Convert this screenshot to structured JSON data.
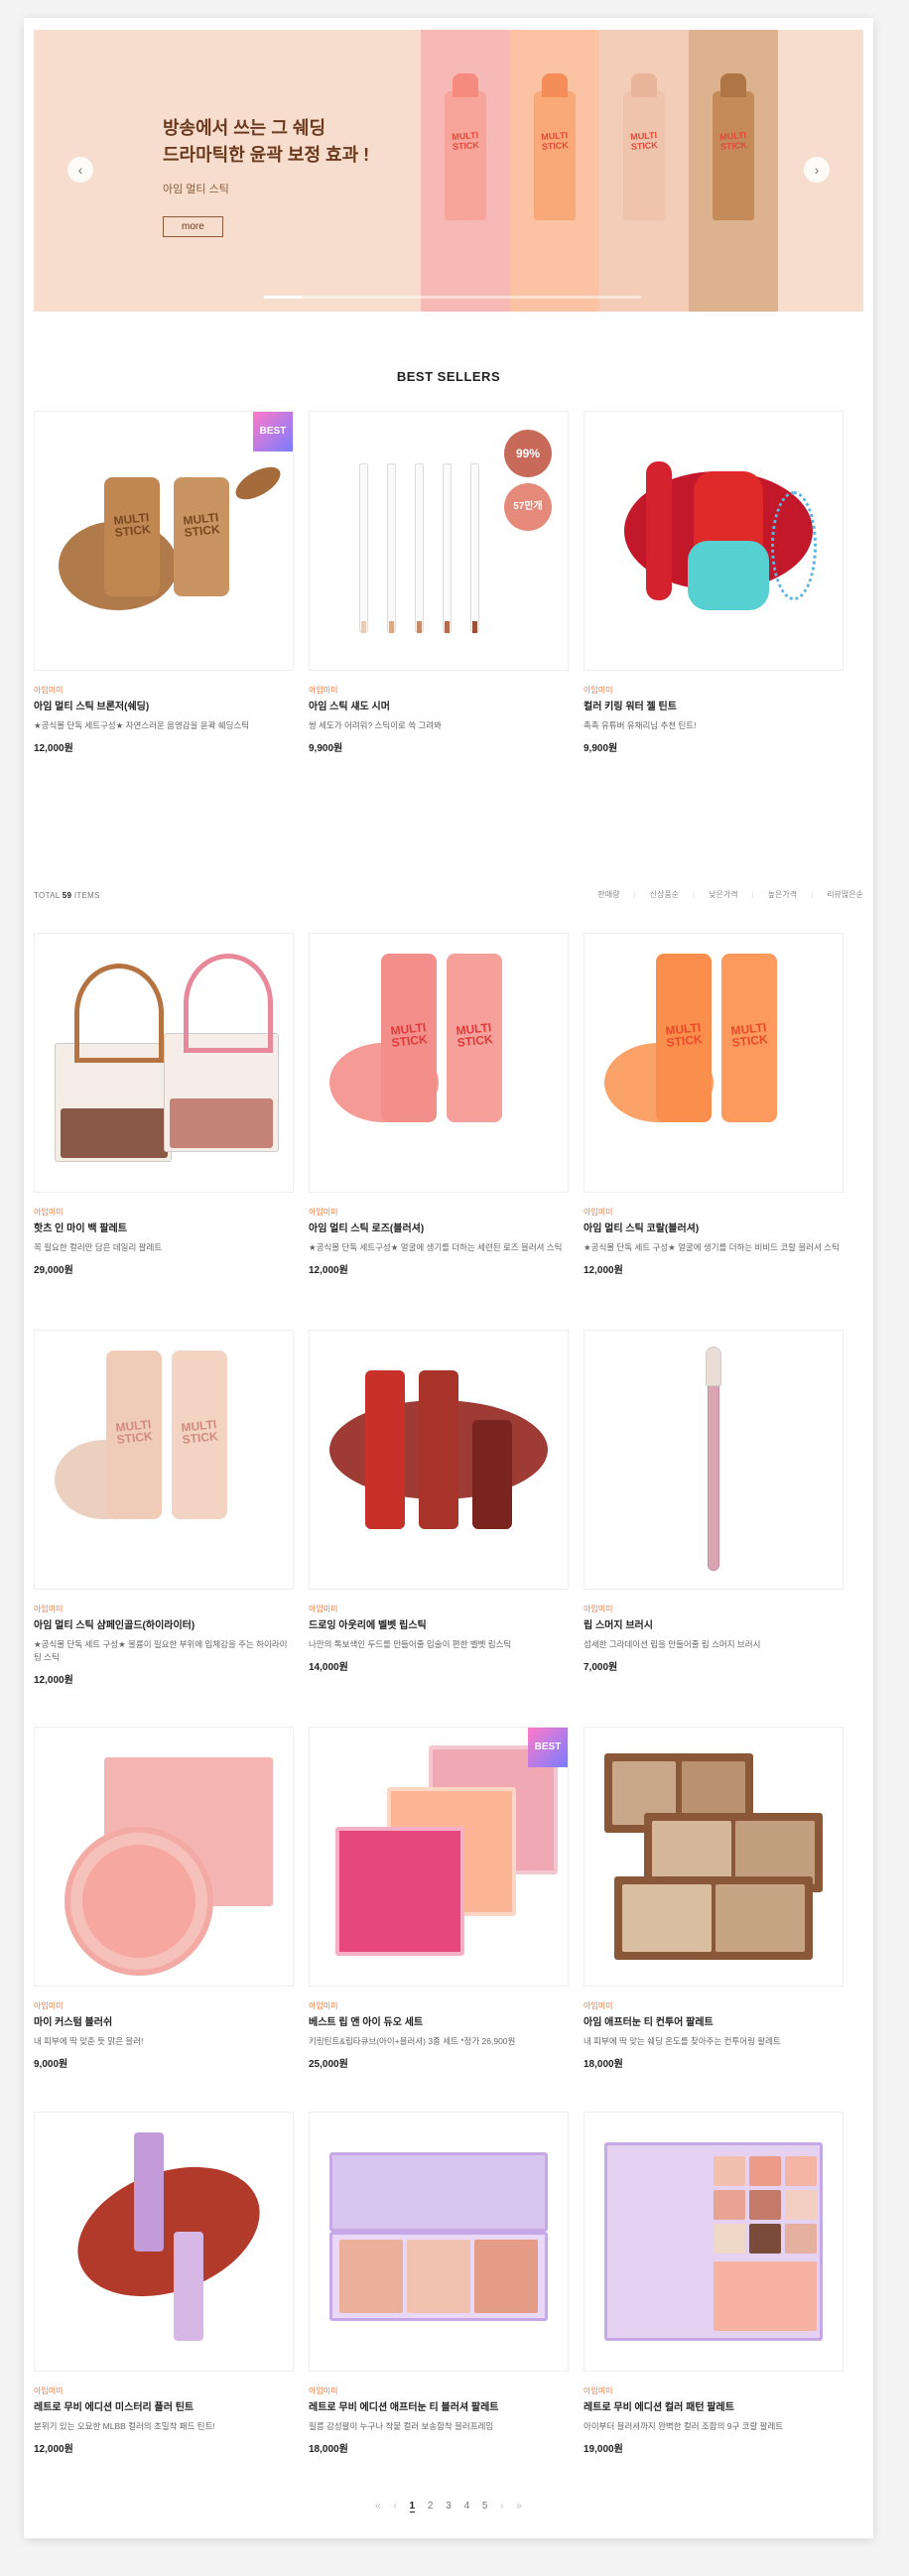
{
  "banner": {
    "title": "방송에서 쓰는 그 쉐딩\n드라마틱한 윤곽 보정 효과 !",
    "subtitle": "아임 멀티 스틱",
    "more_label": "more",
    "prev_icon": "‹",
    "next_icon": "›",
    "sticks": [
      {
        "label": "MULTI STICK",
        "bg": "#f6b9b6",
        "color": "#f38478"
      },
      {
        "label": "MULTI STICK",
        "bg": "#fbc2a3",
        "color": "#f58d59"
      },
      {
        "label": "MULTI STICK",
        "bg": "#f3cdb8",
        "color": "#e9b59a"
      },
      {
        "label": "MULTI STICK",
        "bg": "#dcb38e",
        "color": "#b07545"
      }
    ]
  },
  "best_sellers": {
    "title": "BEST SELLERS",
    "badge": "BEST",
    "bubble_top": "99%",
    "bubble_bottom": "57만개",
    "items": [
      {
        "brand": "아임미미",
        "name": "아임 멀티 스틱 브론저(쉐딩)",
        "desc": "★공식몰 단독 세트구성★ 자연스러운 음영감을 윤곽 쉐딩스틱",
        "price": "12,000원"
      },
      {
        "brand": "아임미미",
        "name": "아임 스틱 섀도 시머",
        "desc": "쌍 세도가 어려워? 스틱이로 쓱 그려봐",
        "price": "9,900원"
      },
      {
        "brand": "아임미미",
        "name": "컬러 키링 워터 젤 틴트",
        "desc": "촉촉 유튜버 유채리님 추천 틴트!",
        "price": "9,900원"
      }
    ]
  },
  "listing": {
    "total_prefix": "TOTAL",
    "total_count": "59",
    "total_suffix": "ITEMS",
    "sort_options": [
      "판매량",
      "신상품순",
      "낮은가격",
      "높은가격",
      "리뷰많은순"
    ]
  },
  "products": [
    {
      "brand": "아임미미",
      "name": "핫츠 인 마이 백 팔레트",
      "desc": "꼭 필요한 컬러만 담은 데일리 팔레트",
      "price": "29,000원"
    },
    {
      "brand": "아임미미",
      "name": "아임 멀티 스틱 로즈(블러셔)",
      "desc": "★공식몰 단독 세트구성★ 얼굴에 생기를 더하는 세련된 로즈 블러셔 스틱",
      "price": "12,000원"
    },
    {
      "brand": "아임미미",
      "name": "아임 멀티 스틱 코랄(블러셔)",
      "desc": "★공식몰 단독 세트 구성★ 얼굴에 생기를 더하는 비비드 코랄 블러셔 스틱",
      "price": "12,000원"
    },
    {
      "brand": "아임미미",
      "name": "아임 멀티 스틱 샴페인골드(하이라이터)",
      "desc": "★공식몰 단독 세트 구성★ 볼륨이 필요한 부위에 입체감을 주는 하이라이팅 스틱",
      "price": "12,000원"
    },
    {
      "brand": "아임미미",
      "name": "드로잉 아웃리에 벨벳 립스틱",
      "desc": "나만의 톡보색인 두드를 만들어줄 입술이 편한 벨벳 립스틱",
      "price": "14,000원"
    },
    {
      "brand": "아임미미",
      "name": "립 스머지 브러시",
      "desc": "섬세한 그라데이션 립을 만들어줄 립 스머지 브러시",
      "price": "7,000원"
    },
    {
      "brand": "아임미미",
      "name": "마이 커스텀 블러쉬",
      "desc": "내 피부에 딱 맞춘 듯 맑은 블러!",
      "price": "9,000원"
    },
    {
      "brand": "아임미미",
      "name": "베스트 립 앤 아이 듀오 세트",
      "desc": "키링틴트&립타큐브(아이+블러셔) 3종 세트 *정가 26,900원",
      "price": "25,000원"
    },
    {
      "brand": "아임미미",
      "name": "아임 애프터눈 티 컨투어 팔레트",
      "desc": "내 피부에 딱 맞는 쉐딩 온도를 찾아주는 컨투어링 팔레트",
      "price": "18,000원"
    },
    {
      "brand": "아임미미",
      "name": "레트로 무비 에디션 미스터리 플러 틴트",
      "desc": "분위기 있는 오묘한 MLBB 컬러의 초밀착 패드 틴트!",
      "price": "12,000원"
    },
    {
      "brand": "아임미미",
      "name": "레트로 무비 에디션 애프터눈 티 블러셔 팔레트",
      "desc": "필름 감성팔이 누구나 착붙 컬러 보송함착 블러프레임",
      "price": "18,000원"
    },
    {
      "brand": "아임미미",
      "name": "레트로 무비 에디션 컬러 패턴 팔레트",
      "desc": "아이부터 블러셔까지 완벽한 컬러 조합의 9구 코랄 팔레트",
      "price": "19,000원"
    }
  ],
  "pagination": {
    "first": "«",
    "prev": "‹",
    "pages": [
      "1",
      "2",
      "3",
      "4",
      "5"
    ],
    "next": "›",
    "last": "»"
  }
}
